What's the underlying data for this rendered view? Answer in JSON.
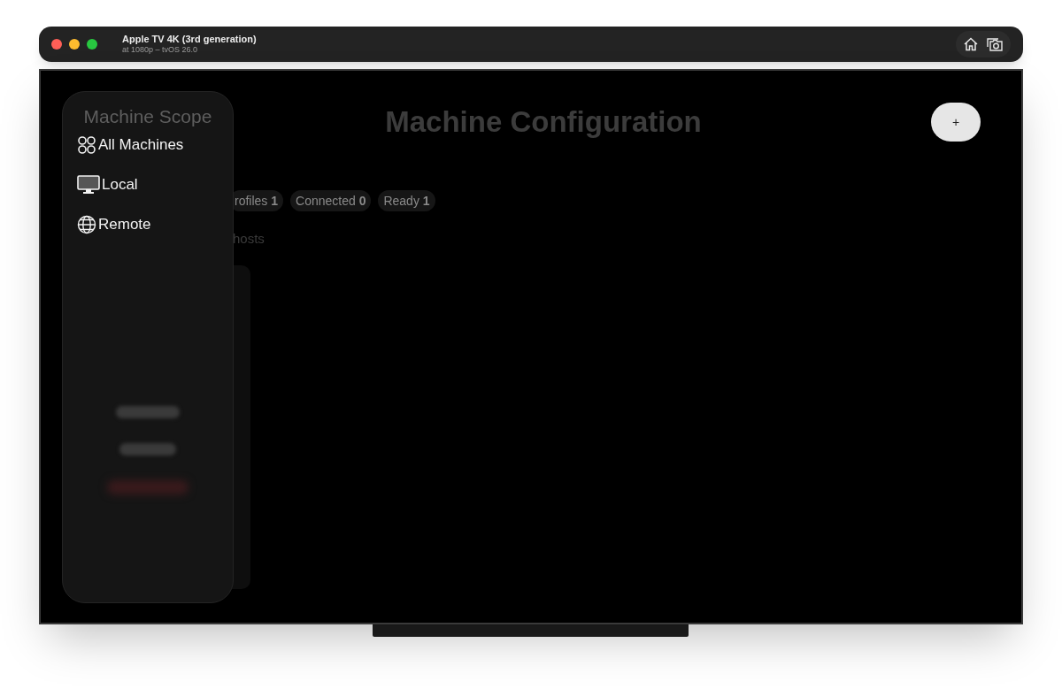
{
  "window": {
    "title": "Apple TV 4K (3rd generation)",
    "subtitle": "at 1080p – tvOS 26.0",
    "toolbar": [
      {
        "kind": "home"
      },
      {
        "kind": "screenshot"
      }
    ]
  },
  "screen": {
    "heading": "Machine Configuration",
    "add_button": "+",
    "stats": [
      {
        "text": "rofiles **1**"
      },
      {
        "text": "Connected **0**"
      },
      {
        "text": "Ready **1**"
      }
    ],
    "hosts_label": "hosts"
  },
  "sidebar": {
    "title": "Machine Scope",
    "items": [
      {
        "label": "All Machines",
        "kind": "grid"
      },
      {
        "label": "Local",
        "kind": "display"
      },
      {
        "label": "Remote",
        "kind": "globe"
      }
    ]
  }
}
